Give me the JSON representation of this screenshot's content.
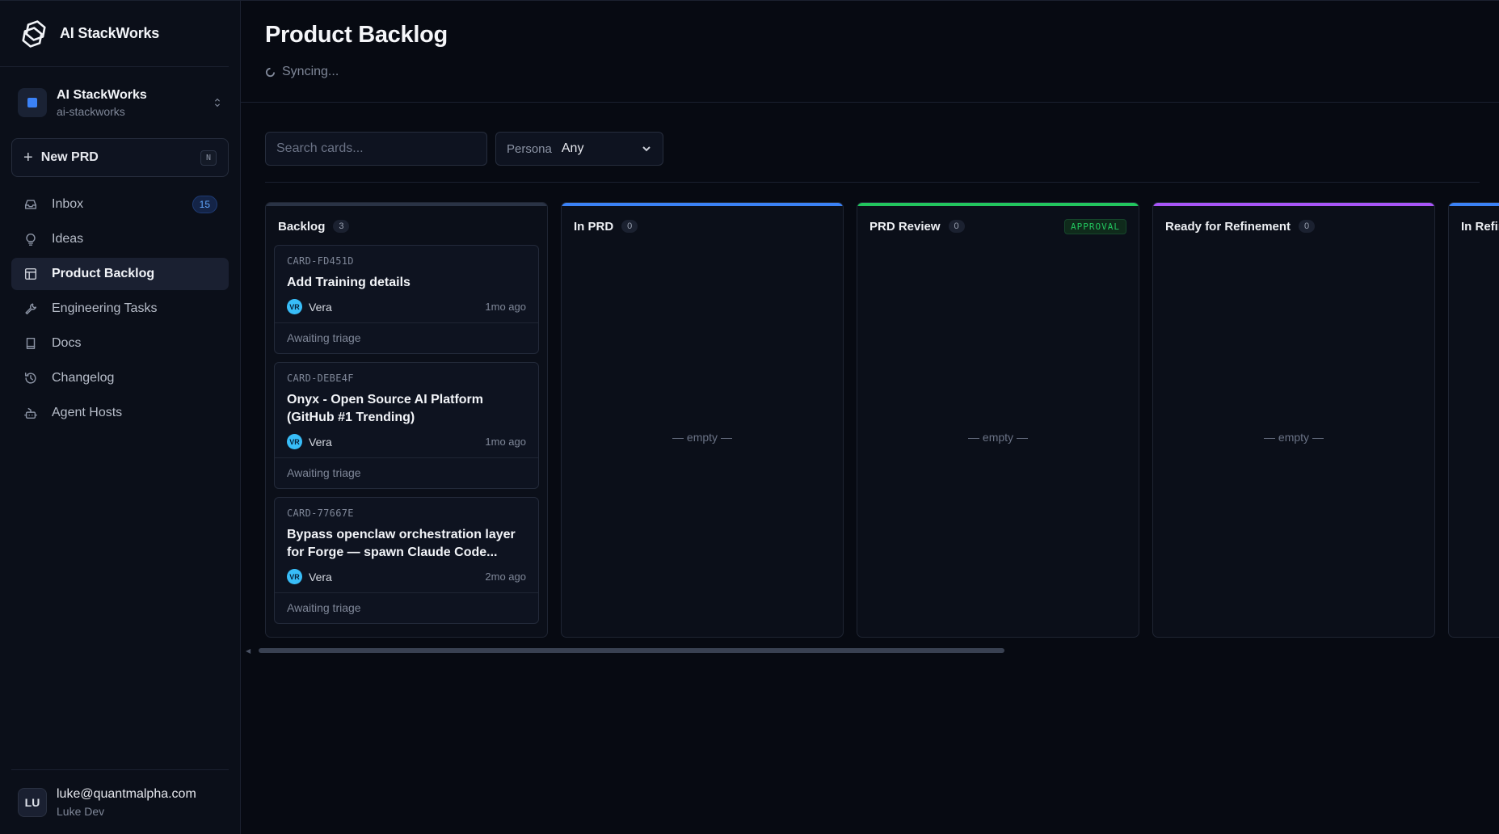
{
  "brand": {
    "name": "AI StackWorks"
  },
  "workspace": {
    "name": "AI StackWorks",
    "slug": "ai-stackworks"
  },
  "new_prd": {
    "label": "New PRD",
    "shortcut": "N"
  },
  "nav": [
    {
      "label": "Inbox",
      "icon": "inbox-icon",
      "count": "15"
    },
    {
      "label": "Ideas",
      "icon": "lightbulb-icon"
    },
    {
      "label": "Product Backlog",
      "icon": "board-icon",
      "active": true
    },
    {
      "label": "Engineering Tasks",
      "icon": "wrench-icon"
    },
    {
      "label": "Docs",
      "icon": "book-icon"
    },
    {
      "label": "Changelog",
      "icon": "history-icon"
    },
    {
      "label": "Agent Hosts",
      "icon": "robot-icon"
    }
  ],
  "user": {
    "initials": "LU",
    "email": "luke@quantmalpha.com",
    "name": "Luke Dev"
  },
  "page": {
    "title": "Product Backlog",
    "status": "Syncing..."
  },
  "filters": {
    "search_placeholder": "Search cards...",
    "persona_label": "Persona",
    "persona_value": "Any"
  },
  "columns": [
    {
      "title": "Backlog",
      "count": "3",
      "color": "#2a3345",
      "cards": [
        {
          "id": "CARD-FD451D",
          "title": "Add Training details",
          "assignee_initials": "VR",
          "assignee": "Vera",
          "time": "1mo ago",
          "status": "Awaiting triage"
        },
        {
          "id": "CARD-DEBE4F",
          "title": "Onyx - Open Source AI Platform (GitHub #1 Trending)",
          "assignee_initials": "VR",
          "assignee": "Vera",
          "time": "1mo ago",
          "status": "Awaiting triage"
        },
        {
          "id": "CARD-77667E",
          "title": "Bypass openclaw orchestration layer for Forge — spawn Claude Code...",
          "assignee_initials": "VR",
          "assignee": "Vera",
          "time": "2mo ago",
          "status": "Awaiting triage"
        }
      ]
    },
    {
      "title": "In PRD",
      "count": "0",
      "color": "#3b82f6",
      "empty": "— empty —"
    },
    {
      "title": "PRD Review",
      "count": "0",
      "color": "#22c55e",
      "tag": "APPROVAL",
      "empty": "— empty —"
    },
    {
      "title": "Ready for Refinement",
      "count": "0",
      "color": "#a855f7",
      "empty": "— empty —"
    },
    {
      "title": "In Refin",
      "color": "#3b82f6"
    }
  ]
}
